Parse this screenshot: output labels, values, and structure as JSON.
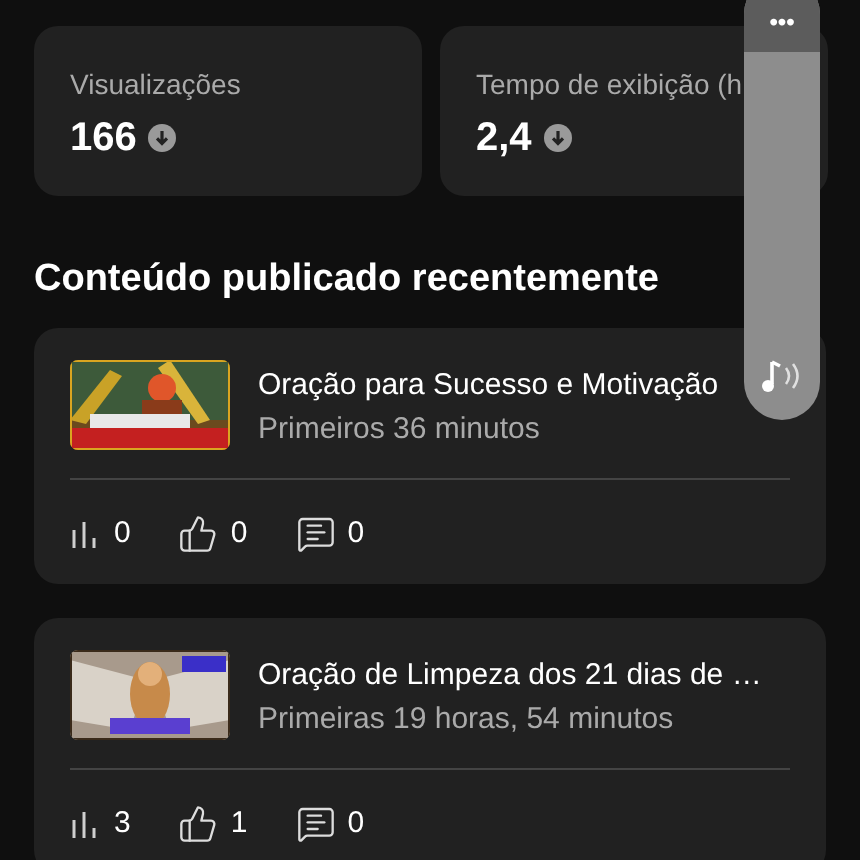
{
  "stats": [
    {
      "label": "Visualizações",
      "value": "166"
    },
    {
      "label": "Tempo de exibição (h",
      "value": "2,4"
    }
  ],
  "section_title": "Conteúdo publicado recentemente",
  "videos": [
    {
      "title": "Oração para Sucesso e Motivação",
      "subtitle": "Primeiros 36 minutos",
      "views": "0",
      "likes": "0",
      "comments": "0"
    },
    {
      "title": "Oração de Limpeza dos 21 dias de …",
      "subtitle": "Primeiras 19 horas, 54 minutos",
      "views": "3",
      "likes": "1",
      "comments": "0"
    }
  ],
  "overlay": {
    "menu": "•••"
  }
}
